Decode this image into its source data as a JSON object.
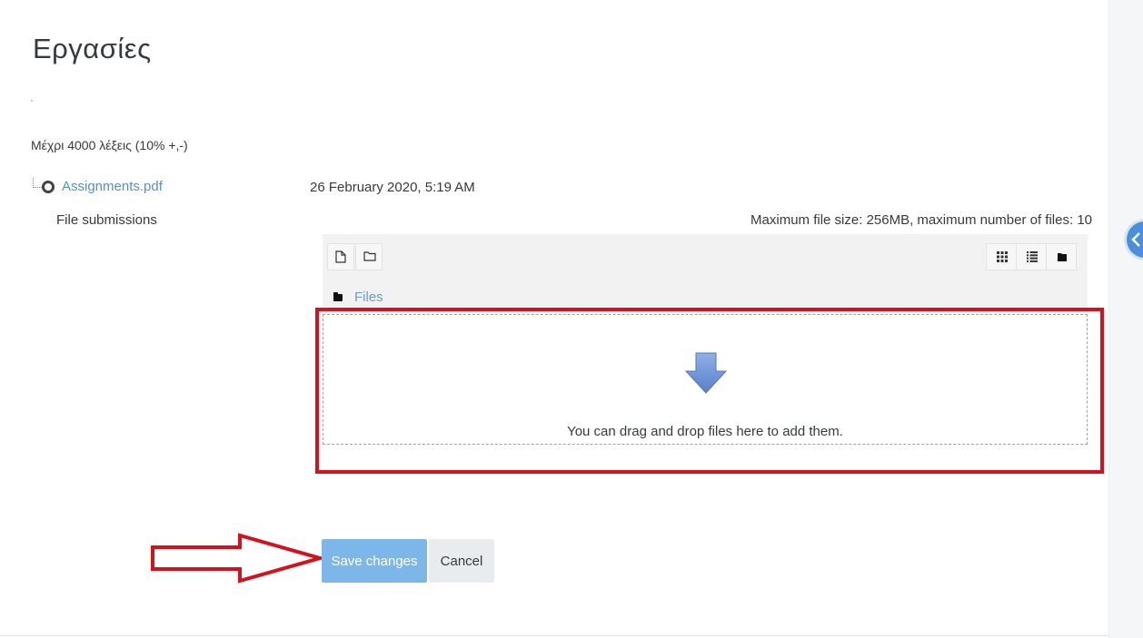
{
  "page": {
    "title": "Εργασίες"
  },
  "assignment": {
    "note": "Μέχρι 4000 λέξεις (10% +,-)",
    "attachment": {
      "name": "Assignments.pdf",
      "date": "26 February 2020, 5:19 AM"
    }
  },
  "submission": {
    "label": "File submissions",
    "limits": "Maximum file size: 256MB, maximum number of files: 10",
    "toolbar": {
      "left_icons": [
        "add-file-icon",
        "create-folder-icon"
      ],
      "view_icons": [
        "grid-view-icon",
        "list-view-icon",
        "tree-view-icon"
      ]
    },
    "path": {
      "folder": "Files"
    },
    "dropzone": {
      "text": "You can drag and drop files here to add them.",
      "icon": "download-arrow-icon"
    }
  },
  "actions": {
    "save_label": "Save changes",
    "cancel_label": "Cancel"
  },
  "colors": {
    "accent": "#7db7ea",
    "link": "#5b8ec4",
    "highlight": "#d3121e",
    "drop_arrow": "#6a8fd4"
  }
}
